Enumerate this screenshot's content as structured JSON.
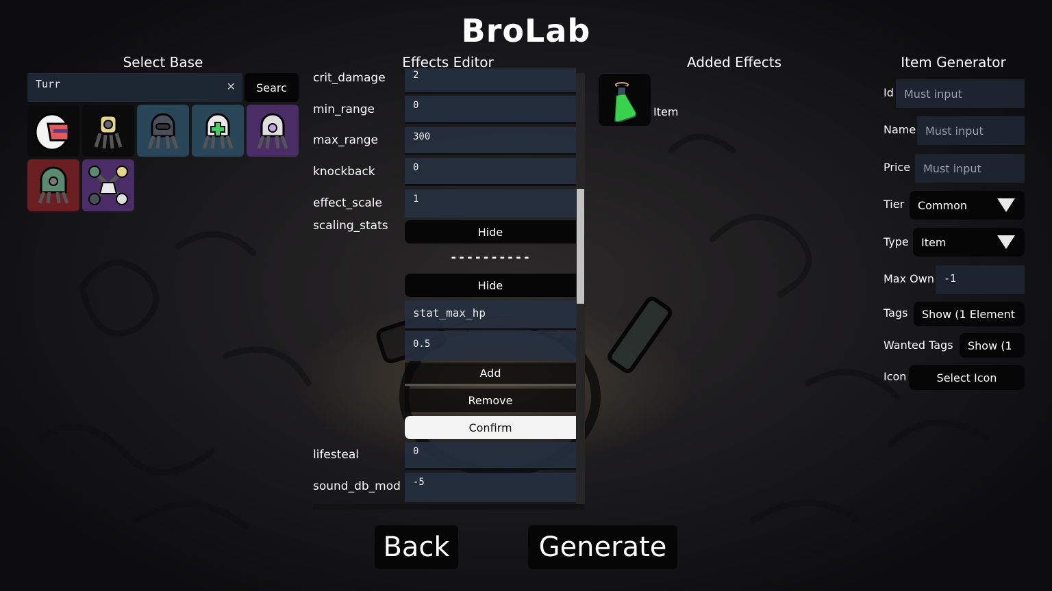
{
  "app": {
    "title": "BroLab"
  },
  "select_base": {
    "title": "Select Base",
    "search": {
      "value": "Turr",
      "placeholder": "",
      "clear_icon": "close-icon"
    },
    "search_button": "Searc",
    "tiles": [
      {
        "name": "helmet-turret",
        "bg": "#0b0b0b"
      },
      {
        "name": "yellow-turret",
        "bg": "#0b0b0b"
      },
      {
        "name": "visor-turret",
        "bg": "#2a4659"
      },
      {
        "name": "healing-turret",
        "bg": "#2a4659"
      },
      {
        "name": "laser-turret",
        "bg": "#4a2d66"
      },
      {
        "name": "green-turret",
        "bg": "#6b1f22"
      },
      {
        "name": "turret-cluster",
        "bg": "#4a2d66"
      }
    ]
  },
  "effects_editor": {
    "title": "Effects Editor",
    "fields": [
      {
        "label": "crit_damage",
        "value": "2"
      },
      {
        "label": "min_range",
        "value": "0"
      },
      {
        "label": "max_range",
        "value": "300"
      },
      {
        "label": "knockback",
        "value": "0"
      },
      {
        "label": "effect_scale",
        "value": "1"
      }
    ],
    "scaling_stats": {
      "label": "scaling_stats",
      "hide_button_1": "Hide",
      "separator": "----------",
      "hide_button_2": "Hide",
      "stat_name": "stat_max_hp",
      "stat_value": "0.5",
      "add_button": "Add",
      "remove_button": "Remove",
      "confirm_button": "Confirm"
    },
    "fields_after": [
      {
        "label": "lifesteal",
        "value": "0"
      },
      {
        "label": "sound_db_mod",
        "value": "-5"
      }
    ]
  },
  "added_effects": {
    "title": "Added Effects",
    "items": [
      {
        "label": "Item",
        "icon": "potion-icon"
      }
    ]
  },
  "item_generator": {
    "title": "Item Generator",
    "id": {
      "label": "Id",
      "placeholder": "Must input",
      "value": ""
    },
    "name": {
      "label": "Name",
      "placeholder": "Must input",
      "value": ""
    },
    "price": {
      "label": "Price",
      "placeholder": "Must input",
      "value": ""
    },
    "tier": {
      "label": "Tier",
      "selected": "Common"
    },
    "type": {
      "label": "Type",
      "selected": "Item"
    },
    "max_own": {
      "label": "Max Own",
      "value": "-1"
    },
    "tags": {
      "label": "Tags",
      "button": "Show (1 Element"
    },
    "wanted_tags": {
      "label": "Wanted Tags",
      "button": "Show (1"
    },
    "icon": {
      "label": "Icon",
      "button": "Select Icon"
    }
  },
  "footer": {
    "back_label": "Back",
    "generate_label": "Generate"
  }
}
